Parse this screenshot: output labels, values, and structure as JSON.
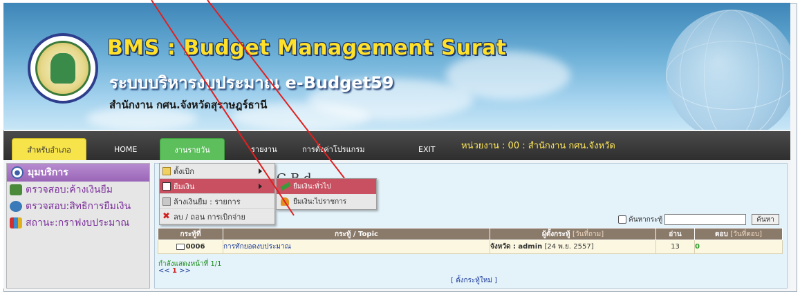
{
  "header": {
    "title": "BMS : Budget Management Surat",
    "subtitle": "ระบบบริหารงบประมาณ e-Budget59",
    "office": "สำนักงาน กศน.จังหวัดสุราษฎร์ธานี"
  },
  "nav": {
    "items": [
      {
        "label": "สำหรับอำเภอ"
      },
      {
        "label": "HOME"
      },
      {
        "label": "งานรายวัน"
      },
      {
        "label": "รายงาน"
      },
      {
        "label": "การตั้งค่าโปรแกรม"
      },
      {
        "label": "EXIT"
      }
    ],
    "unit": "หน่วยงาน : 00 : สำนักงาน กศน.จังหวัด"
  },
  "dropdown": {
    "items": [
      {
        "label": "ตั้งเบิก"
      },
      {
        "label": "ยืมเงิน"
      },
      {
        "label": "ล้างเงินยืม : รายการ"
      },
      {
        "label": "ลบ / ถอน การเบิกจ่าย"
      }
    ]
  },
  "submenu": {
    "items": [
      {
        "label": "ยืมเงิน:ทั่วไป"
      },
      {
        "label": "ยืมเงิน:ไปราชการ"
      }
    ]
  },
  "sidebar": {
    "title": "มุมบริการ",
    "items": [
      {
        "label": "ตรวจสอบ:ค้างเงินยืม"
      },
      {
        "label": "ตรวจสอบ:สิทธิการยืมเงิน"
      },
      {
        "label": "สถานะ:กราฟงบประมาณ"
      }
    ]
  },
  "main": {
    "title_fragment": "G   B   d",
    "search_label": "ค้นหากระทู้",
    "search_button": "ค้นหา",
    "table": {
      "headers": {
        "no": "กระทู้ที่",
        "topic": "กระทู้ / Topic",
        "creator": "ผู้ตั้งกระทู้",
        "creator_sub": "[วันที่ถาม]",
        "read": "อ่าน",
        "reply": "ตอบ",
        "reply_sub": "[วันที่ตอบ]"
      },
      "rows": [
        {
          "no": "0006",
          "topic": "การทักยอดงบประมาณ",
          "creator_prefix": "จังหวัด : admin",
          "creator_date": "[24 พ.ย. 2557]",
          "read": "13",
          "reply": "0"
        }
      ]
    },
    "page_info": "กำลังแสดงหน้าที่ 1/1",
    "pager_prev": "<<",
    "pager_current": "1",
    "pager_next": ">>",
    "new_topic": "[ ตั้งกระทู้ใหม่ ]"
  },
  "colors": {
    "nav_bg": "#333333",
    "active_menu": "#c85060",
    "title_yellow": "#ffe02a",
    "sidebar_header": "#9a66b8"
  }
}
